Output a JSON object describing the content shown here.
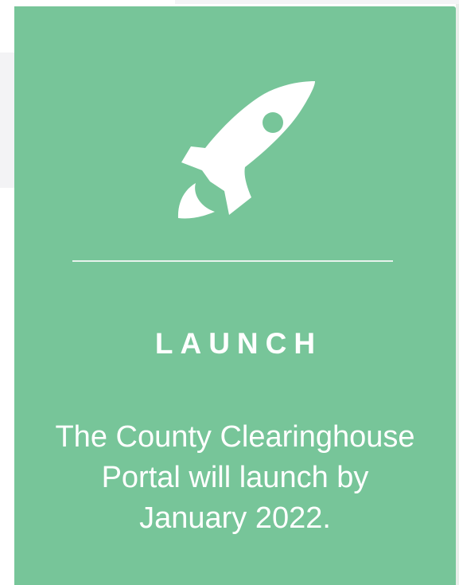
{
  "card": {
    "title": "LAUNCH",
    "description": "The County Clearinghouse Portal will launch by January 2022.",
    "icon": "rocket-icon"
  },
  "colors": {
    "card_background": "#77c599",
    "text": "#ffffff",
    "icon": "#ffffff"
  }
}
